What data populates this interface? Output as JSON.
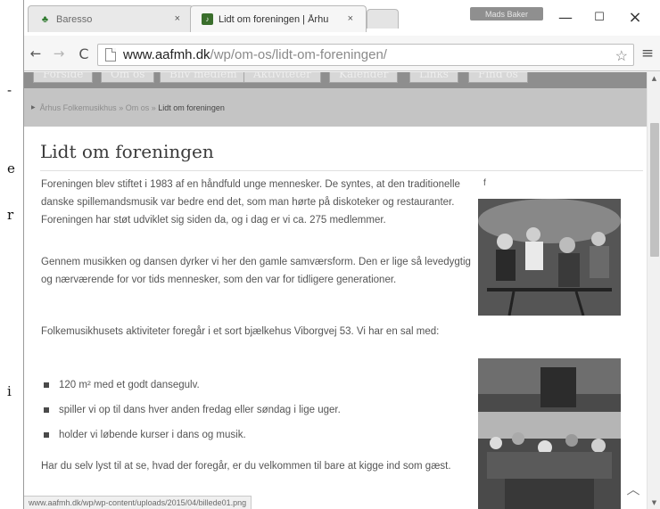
{
  "background_doc": {
    "fragments": [
      "-",
      "e",
      "r",
      "i"
    ]
  },
  "browser": {
    "tabs": [
      {
        "title": "Baresso",
        "close": "×",
        "active": false
      },
      {
        "title": "Lidt om foreningen | Århu",
        "close": "×",
        "active": true
      }
    ],
    "profile_name": "Mads Baker",
    "window_controls": {
      "minimize": "—",
      "maximize": "☐",
      "close": "×"
    },
    "toolbar": {
      "back": "←",
      "forward": "→",
      "reload": "C",
      "star": "☆",
      "menu": "≡"
    },
    "url": {
      "host": "www.aafmh.dk",
      "path": "/wp/om-os/lidt-om-foreningen/"
    }
  },
  "site_nav": {
    "items": [
      "Forside",
      "Om os",
      "Bliv medlem",
      "Aktiviteter",
      "Kalender",
      "Links",
      "Find os"
    ]
  },
  "breadcrumb": {
    "items": [
      "Århus Folkemusikhus",
      "Om os",
      "Lidt om foreningen"
    ],
    "separator": "»"
  },
  "article": {
    "title": "Lidt om foreningen",
    "caption": "f",
    "paragraphs": [
      "Foreningen blev stiftet i 1983 af en håndfuld unge mennesker. De syntes, at den traditionelle danske spillemandsmusik var bedre end det, som man hørte på diskoteker og restauranter. Foreningen har støt udviklet sig siden da, og i dag er vi ca. 275 medlemmer.",
      "Gennem musikken og dansen dyrker vi her den gamle samværsform. Den er lige så levedygtig og nærværende for vor tids mennesker, som den var for tidligere generationer.",
      "Folkemusikhusets aktiviteter foregår i et sort bjælkehus Viborgvej 53. Vi har en sal med:",
      "Har du selv lyst til at se, hvad der foregår, er du velkommen til bare at kigge ind som gæst."
    ],
    "bullets": [
      "120 m² med et godt dansegulv.",
      "spiller vi op til dans hver anden fredag eller søndag i lige uger.",
      "holder vi løbende kurser i dans og musik."
    ]
  },
  "status_bar": {
    "url": "www.aafmh.dk/wp/wp-content/uploads/2015/04/billede01.png"
  },
  "back_to_top": "︿",
  "scrollbar": {
    "up": "▲",
    "down": "▼"
  },
  "colors": {
    "nav_bg": "#8e8e8e",
    "breadcrumb_bg": "#c4c4c4",
    "body_text": "#555555",
    "title_text": "#3a3a3a"
  }
}
